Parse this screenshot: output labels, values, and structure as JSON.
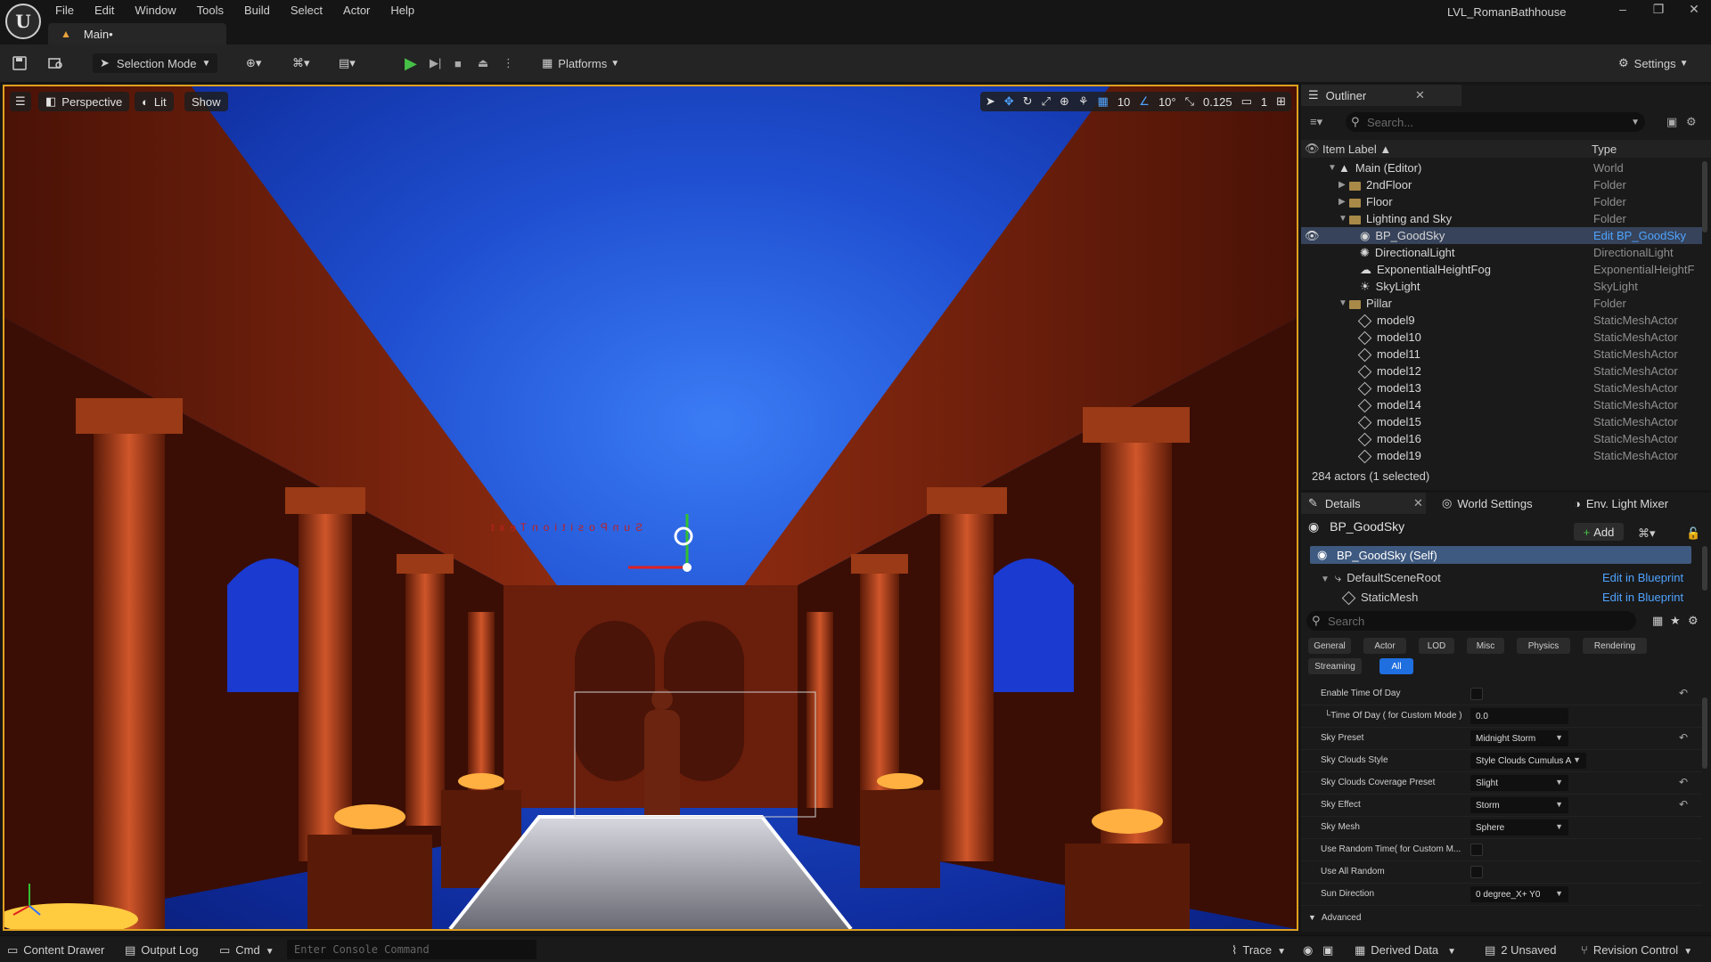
{
  "menubar": {
    "items": [
      "File",
      "Edit",
      "Window",
      "Tools",
      "Build",
      "Select",
      "Actor",
      "Help"
    ],
    "window_title": "LVL_RomanBathhouse"
  },
  "tabs": {
    "main": "Main•"
  },
  "toolbar": {
    "selection_mode": "Selection Mode",
    "platforms": "Platforms",
    "settings": "Settings"
  },
  "viewport": {
    "perspective": "Perspective",
    "lit": "Lit",
    "show": "Show",
    "grid_snap": "10",
    "rotation_snap": "10°",
    "scale_snap": "0.125",
    "camera_speed": "1",
    "sky_label": "SunPositionText"
  },
  "outliner": {
    "tab": "Outliner",
    "search_placeholder": "Search...",
    "col_label": "Item Label ▲",
    "col_type": "Type",
    "rows": [
      {
        "label": "Main (Editor)",
        "type": "World"
      },
      {
        "label": "2ndFloor",
        "type": "Folder"
      },
      {
        "label": "Floor",
        "type": "Folder"
      },
      {
        "label": "Lighting and Sky",
        "type": "Folder"
      },
      {
        "label": "BP_GoodSky",
        "type": "Edit BP_GoodSky"
      },
      {
        "label": "DirectionalLight",
        "type": "DirectionalLight"
      },
      {
        "label": "ExponentialHeightFog",
        "type": "ExponentialHeightF"
      },
      {
        "label": "SkyLight",
        "type": "SkyLight"
      },
      {
        "label": "Pillar",
        "type": "Folder"
      },
      {
        "label": "model9",
        "type": "StaticMeshActor"
      },
      {
        "label": "model10",
        "type": "StaticMeshActor"
      },
      {
        "label": "model11",
        "type": "StaticMeshActor"
      },
      {
        "label": "model12",
        "type": "StaticMeshActor"
      },
      {
        "label": "model13",
        "type": "StaticMeshActor"
      },
      {
        "label": "model14",
        "type": "StaticMeshActor"
      },
      {
        "label": "model15",
        "type": "StaticMeshActor"
      },
      {
        "label": "model16",
        "type": "StaticMeshActor"
      },
      {
        "label": "model19",
        "type": "StaticMeshActor"
      }
    ],
    "count": "284 actors (1 selected)"
  },
  "details": {
    "tab_details": "Details",
    "tab_world": "World Settings",
    "tab_env": "Env. Light Mixer",
    "actor": "BP_GoodSky",
    "add": "Add",
    "self_row": "BP_GoodSky (Self)",
    "comp1": "DefaultSceneRoot",
    "comp2": "StaticMesh",
    "edit_bp": "Edit in Blueprint",
    "search_placeholder": "Search",
    "cats": [
      "General",
      "Actor",
      "LOD",
      "Misc",
      "Physics",
      "Rendering",
      "Streaming",
      "All"
    ],
    "props": [
      {
        "label": "Enable Time Of Day",
        "kind": "check",
        "value": ""
      },
      {
        "label": "└Time Of Day ( for Custom Mode )",
        "kind": "text",
        "value": "0.0"
      },
      {
        "label": "Sky Preset",
        "kind": "dropdown",
        "value": "Midnight Storm"
      },
      {
        "label": "Sky Clouds Style",
        "kind": "dropdown",
        "value": "Style Clouds Cumulus A"
      },
      {
        "label": "Sky Clouds Coverage Preset",
        "kind": "dropdown",
        "value": "Slight"
      },
      {
        "label": "Sky Effect",
        "kind": "dropdown",
        "value": "Storm"
      },
      {
        "label": "Sky Mesh",
        "kind": "dropdown",
        "value": "Sphere"
      },
      {
        "label": "Use Random Time( for Custom M...",
        "kind": "check",
        "value": ""
      },
      {
        "label": "Use All Random",
        "kind": "check",
        "value": ""
      },
      {
        "label": "Sun Direction",
        "kind": "dropdown",
        "value": "0 degree_X+ Y0"
      }
    ],
    "advanced": "Advanced"
  },
  "status": {
    "content_drawer": "Content Drawer",
    "output_log": "Output Log",
    "cmd": "Cmd",
    "console_placeholder": "Enter Console Command",
    "trace": "Trace",
    "derived": "Derived Data",
    "unsaved": "2 Unsaved",
    "revision": "Revision Control"
  }
}
